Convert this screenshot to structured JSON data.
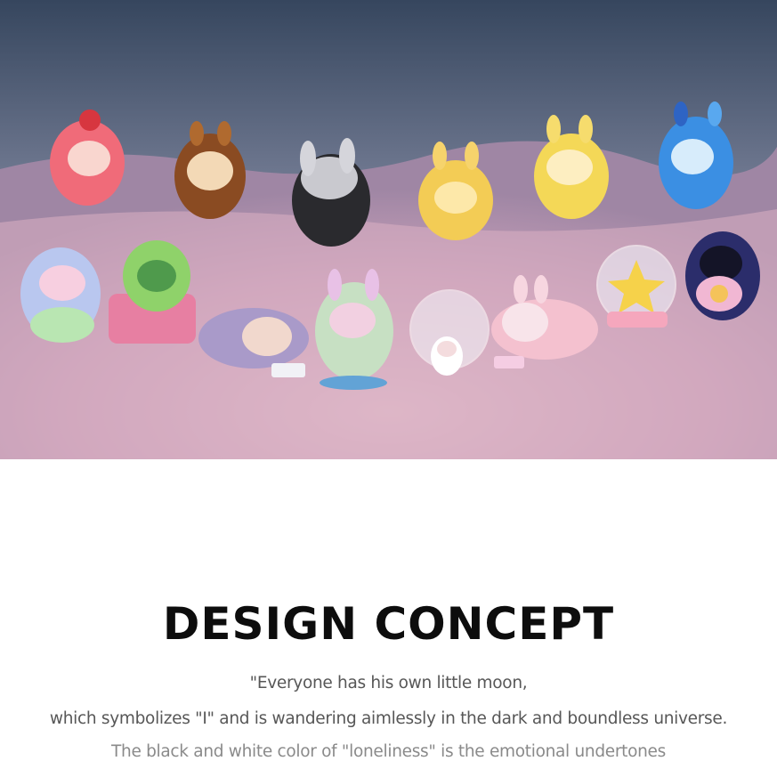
{
  "hero": {
    "scene": "toy-figures-on-moon-surface"
  },
  "concept": {
    "title": "DESIGN CONCEPT",
    "lines": [
      "\"Everyone has his own little moon,",
      "which symbolizes \"I\" and is wandering aimlessly in the dark and boundless universe.",
      "The black and white color of \"loneliness\" is the emotional undertones"
    ]
  },
  "colors": {
    "title": "#0d0d0d",
    "body_text": "#575757",
    "background": "#ffffff"
  }
}
